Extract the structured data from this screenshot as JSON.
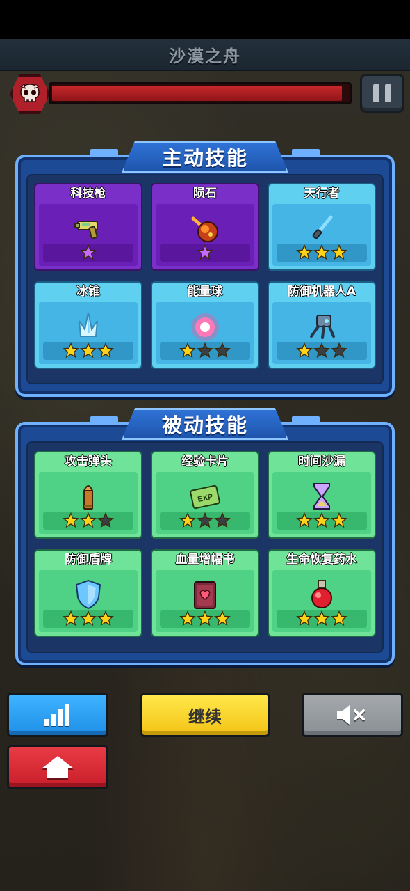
{
  "level": {
    "title": "沙漠之舟",
    "boss_hp_fraction": 0.98
  },
  "active_skills": {
    "title": "主动技能",
    "cards": [
      {
        "label": "科技枪",
        "rarity": "purple",
        "icon": "tech-gun-icon",
        "stars": 1,
        "max_stars": 1
      },
      {
        "label": "陨石",
        "rarity": "purple",
        "icon": "meteor-icon",
        "stars": 1,
        "max_stars": 1
      },
      {
        "label": "天行者",
        "rarity": "cyan",
        "icon": "lightsaber-icon",
        "stars": 3,
        "max_stars": 3
      },
      {
        "label": "冰锥",
        "rarity": "cyan",
        "icon": "ice-spike-icon",
        "stars": 3,
        "max_stars": 3
      },
      {
        "label": "能量球",
        "rarity": "cyan",
        "icon": "energy-orb-icon",
        "stars": 1,
        "max_stars": 3
      },
      {
        "label": "防御机器人A",
        "rarity": "cyan",
        "icon": "defense-robot-icon",
        "stars": 1,
        "max_stars": 3
      }
    ]
  },
  "passive_skills": {
    "title": "被动技能",
    "cards": [
      {
        "label": "攻击弹头",
        "rarity": "green",
        "icon": "bullet-icon",
        "stars": 2,
        "max_stars": 3
      },
      {
        "label": "经验卡片",
        "rarity": "green",
        "icon": "exp-card-icon",
        "stars": 1,
        "max_stars": 3
      },
      {
        "label": "时间沙漏",
        "rarity": "green",
        "icon": "hourglass-icon",
        "stars": 3,
        "max_stars": 3
      },
      {
        "label": "防御盾牌",
        "rarity": "green",
        "icon": "shield-icon",
        "stars": 3,
        "max_stars": 3
      },
      {
        "label": "血量增幅书",
        "rarity": "green",
        "icon": "heart-book-icon",
        "stars": 3,
        "max_stars": 3
      },
      {
        "label": "生命恢复药水",
        "rarity": "green",
        "icon": "potion-icon",
        "stars": 3,
        "max_stars": 3
      }
    ]
  },
  "buttons": {
    "stats_icon": "signal-bars-icon",
    "continue_label": "继续",
    "mute_icon": "speaker-muted-icon",
    "home_icon": "home-icon"
  },
  "exp_card_text": "EXP",
  "colors": {
    "star_filled": "#ffd21a",
    "star_empty": "#3a3f45",
    "purple_star": "#c86cff"
  }
}
